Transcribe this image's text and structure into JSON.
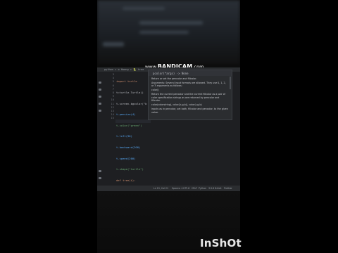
{
  "watermark": {
    "prefix": "www.",
    "brand": "BANDICAM",
    "suffix": ".com"
  },
  "tabs": {
    "path": "python > ⚙ Hwang > 🐍 tree"
  },
  "line_numbers": [
    "3",
    "4",
    "5",
    "6",
    "7",
    "8",
    "9",
    "10",
    "11",
    "12",
    "13",
    "14",
    "15"
  ],
  "code_lines": [
    "import turtle",
    "t=turtle.Turtle()",
    "t.screen.bgcolor(\"b",
    "t.pensize(4)",
    "t.color(\"green\")",
    "t.left(90)",
    "t.backward(200)",
    "t.speed(200)",
    "t.shape(\"turtle\")",
    "def tree(i):",
    "    if i<10:",
    "        return",
    "    else:",
    "        t.forward(i)",
    "        t.color((\""
  ],
  "popup": {
    "signature": "pcolor(*args) -> None",
    "paragraphs": [
      "Return or set the pencolor and fillcolor.",
      "Arguments: Several input formats are allowed. They use 0, 1, 2, or 3 arguments as follows:",
      "color()",
      "Return the current pencolor and the current fillcolor as a pair of color specification strings as are returned by pencolor and fillcolor.",
      "color(colorstring), color((r,g,b)), color(r,g,b)",
      "inputs as in pencolor, set both, fillcolor and pencolor, to the given value."
    ]
  },
  "statusbar": {
    "position": "Ln 15, Col 21",
    "spaces": "Spaces: 4",
    "encoding": "UTF-8",
    "eol": "CRLF",
    "language": "Python",
    "version": "3.9.6 64-bit",
    "prettier": "Prettier"
  },
  "brand": {
    "logo_text": "InShOt"
  },
  "colors": {
    "editor_bg": "#1e1f22",
    "keyword": "#cf8e6d",
    "string": "#6aab73",
    "function": "#56a8f5"
  }
}
